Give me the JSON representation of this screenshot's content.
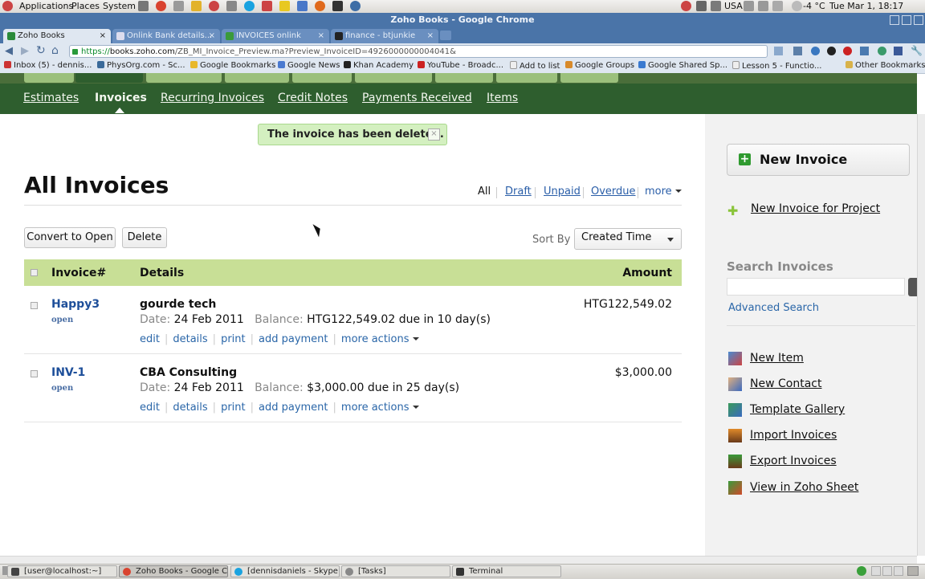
{
  "gnome_panel": {
    "menus": [
      "Applications",
      "Places",
      "System"
    ],
    "keyboard_layout": "USA",
    "weather": "-4 °C",
    "clock": "Tue Mar  1, 18:17"
  },
  "browser": {
    "window_title": "Zoho Books - Google Chrome",
    "tabs": [
      {
        "label": "Zoho Books",
        "active": true
      },
      {
        "label": "Onlink Bank details..."
      },
      {
        "label": "INVOICES onlink"
      },
      {
        "label": "finance - btjunkie"
      }
    ],
    "url_scheme": "https://",
    "url_host": "books.zoho.com",
    "url_path": "/ZB_MI_Invoice_Preview.ma?Preview_InvoiceID=4926000000004041&",
    "bookmarks": [
      "Inbox (5) - dennis...",
      "PhysOrg.com - Sc...",
      "Google Bookmarks",
      "Google News",
      "Khan Academy",
      "YouTube - Broadc...",
      "Add to list",
      "Google Groups",
      "Google Shared Sp...",
      "Lesson 5 - Functio..."
    ],
    "other_bookmarks": "Other Bookmarks"
  },
  "subnav": {
    "items": [
      "Estimates",
      "Invoices",
      "Recurring Invoices",
      "Credit Notes",
      "Payments Received",
      "Items"
    ],
    "active": "Invoices"
  },
  "toast": {
    "message": "The invoice has been deleted.",
    "close": "×"
  },
  "page": {
    "title": "All Invoices",
    "filters": [
      "All",
      "Draft",
      "Unpaid",
      "Overdue",
      "more"
    ],
    "convert_button": "Convert to Open",
    "delete_button": "Delete",
    "sort_label": "Sort By",
    "sort_value": "Created Time"
  },
  "table": {
    "headers": {
      "invoice": "Invoice#",
      "details": "Details",
      "amount": "Amount"
    },
    "rows": [
      {
        "number": "Happy3",
        "status": "open",
        "customer": "gourde tech",
        "date_label": "Date:",
        "date": "24 Feb 2011",
        "balance_label": "Balance:",
        "balance": "HTG122,549.02 due in 10 day(s)",
        "amount": "HTG122,549.02"
      },
      {
        "number": "INV-1",
        "status": "open",
        "customer": "CBA Consulting",
        "date_label": "Date:",
        "date": "24 Feb 2011",
        "balance_label": "Balance:",
        "balance": "$3,000.00 due in 25 day(s)",
        "amount": "$3,000.00"
      }
    ],
    "actions": [
      "edit",
      "details",
      "print",
      "add payment",
      "more actions"
    ]
  },
  "sidebar": {
    "new_invoice": "New Invoice",
    "new_invoice_project": "New Invoice for Project",
    "search_label": "Search Invoices",
    "advanced_search": "Advanced Search",
    "links": [
      "New Item",
      "New Contact",
      "Template Gallery",
      "Import Invoices",
      "Export Invoices",
      "View in Zoho Sheet"
    ]
  },
  "taskbar": {
    "items": [
      "[user@localhost:~]",
      "Zoho Books - Google C...",
      "[dennisdaniels - Skype...",
      "[Tasks]",
      "Terminal"
    ]
  },
  "colors": {
    "nav_green": "#2e5e2e",
    "table_header": "#c8df96",
    "link_blue": "#2a66a8",
    "chrome_blue": "#4a74a8"
  }
}
